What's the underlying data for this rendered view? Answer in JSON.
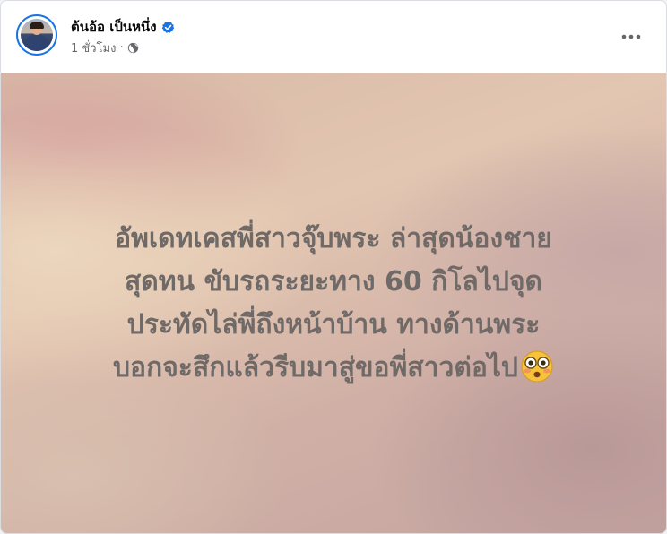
{
  "post": {
    "author": {
      "name": "ต้นอ้อ เป็นหนึ่ง",
      "verified_icon": "verified-badge-icon",
      "avatar": "profile-photo"
    },
    "meta": {
      "time": "1 ชั่วโมง",
      "separator": "·",
      "audience_icon": "globe-icon"
    },
    "more_icon": "more-horizontal-icon",
    "body": {
      "lines": [
        "อัพเดทเคสพี่สาวจุ๊บพระ ล่าสุดน้องชาย",
        "สุดทน ขับรถระยะทาง 60 กิโลไปจุด",
        "ประทัดไล่พี่ถึงหน้าบ้าน ทางด้านพระ",
        "บอกจะสึกแล้วรีบมาสู่ขอพี่สาวต่อไป"
      ],
      "trailing_emoji": "flushed-face-emoji",
      "text_color": "#6f6a67"
    }
  },
  "colors": {
    "verified": "#1b74e4",
    "meta_text": "#65676b",
    "name_text": "#050505"
  }
}
